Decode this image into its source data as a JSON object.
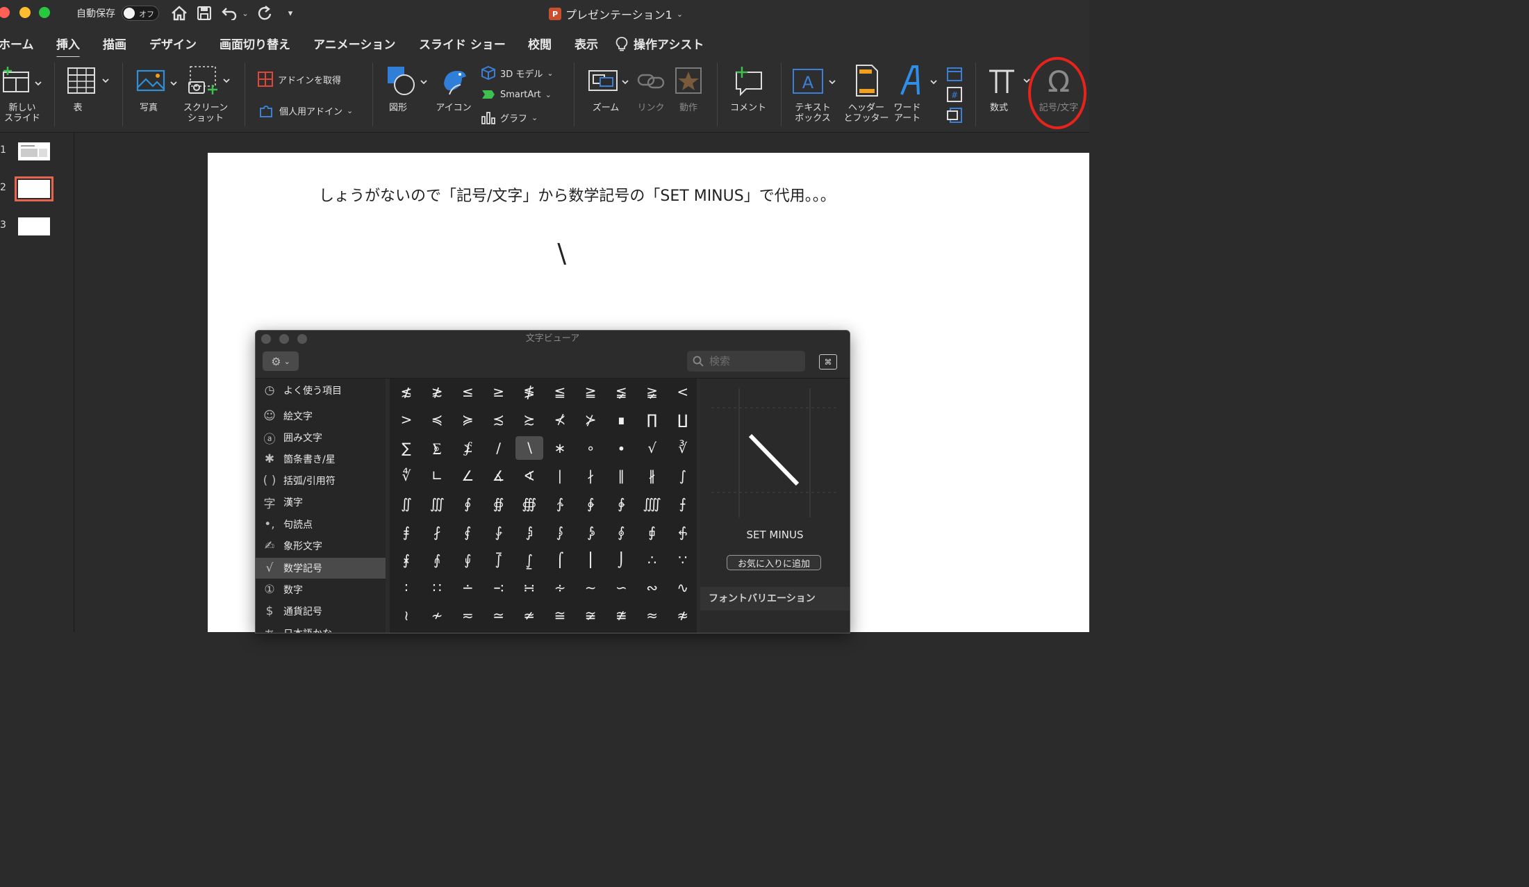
{
  "titlebar": {
    "autosave_label": "自動保存",
    "toggle_state": "オフ",
    "document_title": "プレゼンテーション1",
    "app_badge": "P"
  },
  "tabs": [
    "ホーム",
    "挿入",
    "描画",
    "デザイン",
    "画面切り替え",
    "アニメーション",
    "スライド ショー",
    "校閲",
    "表示",
    "操作アシスト"
  ],
  "active_tab": "挿入",
  "ribbon": {
    "new_slide": "新しい\nスライド",
    "table": "表",
    "photo": "写真",
    "screenshot": "スクリーン\nショット",
    "get_addins": "アドインを取得",
    "my_addins": "個人用アドイン",
    "shapes": "図形",
    "icons": "アイコン",
    "models3d": "3D モデル",
    "smartart": "SmartArt",
    "chart": "グラフ",
    "zoom": "ズーム",
    "link": "リンク",
    "action": "動作",
    "comment": "コメント",
    "textbox": "テキスト\nボックス",
    "header_footer": "ヘッダー\nとフッター",
    "wordart": "ワード\nアート",
    "equation": "数式",
    "symbol": "記号/文字"
  },
  "thumbnails": [
    "1",
    "2",
    "3"
  ],
  "selected_thumbnail": "2",
  "slide": {
    "text": "しょうがないので「記号/文字」から数学記号の「SET MINUS」で代用。。。",
    "symbol": "∖"
  },
  "char_viewer": {
    "title": "文字ビューア",
    "search_placeholder": "検索",
    "categories": [
      {
        "icon": "clock-icon",
        "glyph": "◷",
        "label": "よく使う項目"
      },
      {
        "icon": "smiley-icon",
        "glyph": "☺",
        "label": "絵文字"
      },
      {
        "icon": "circled-a-icon",
        "glyph": "ⓐ",
        "label": "囲み文字"
      },
      {
        "icon": "asterisk-icon",
        "glyph": "✱",
        "label": "箇条書き/星"
      },
      {
        "icon": "parentheses-icon",
        "glyph": "( )",
        "label": "括弧/引用符"
      },
      {
        "icon": "kanji-icon",
        "glyph": "字",
        "label": "漢字"
      },
      {
        "icon": "punctuation-icon",
        "glyph": "•,",
        "label": "句読点"
      },
      {
        "icon": "pictograph-icon",
        "glyph": "✍",
        "label": "象形文字"
      },
      {
        "icon": "sqrt-icon",
        "glyph": "√",
        "label": "数学記号"
      },
      {
        "icon": "circled-one-icon",
        "glyph": "①",
        "label": "数字"
      },
      {
        "icon": "dollar-icon",
        "glyph": "$",
        "label": "通貨記号"
      },
      {
        "icon": "kana-icon",
        "glyph": "あ",
        "label": "日本語かな"
      }
    ],
    "selected_category": "数学記号",
    "grid": [
      [
        "≴",
        "≵",
        "≤",
        "≥",
        "≸",
        "≦",
        "≧",
        "≨",
        "≩",
        "<"
      ],
      [
        ">",
        "≼",
        "≽",
        "≾",
        "≿",
        "⊀",
        "⊁",
        "∎",
        "∏",
        "∐"
      ],
      [
        "∑",
        "⨊",
        "⨋",
        "∕",
        "∖",
        "∗",
        "∘",
        "∙",
        "√",
        "∛"
      ],
      [
        "∜",
        "∟",
        "∠",
        "∡",
        "∢",
        "∣",
        "∤",
        "∥",
        "∦",
        "∫"
      ],
      [
        "∬",
        "∭",
        "∮",
        "∯",
        "∰",
        "∱",
        "∲",
        "∳",
        "⨌",
        "⨍"
      ],
      [
        "⨎",
        "⨏",
        "⨐",
        "⨑",
        "⨒",
        "⨓",
        "⨔",
        "⨕",
        "⨖",
        "⨗"
      ],
      [
        "⨘",
        "⨙",
        "⨚",
        "⨛",
        "⨜",
        "⌠",
        "⎮",
        "⌡",
        "∴",
        "∵"
      ],
      [
        "∶",
        "∷",
        "∸",
        "∹",
        "∺",
        "∻",
        "∼",
        "∽",
        "∾",
        "∿"
      ],
      [
        "≀",
        "≁",
        "≂",
        "≃",
        "≄",
        "≅",
        "≆",
        "≇",
        "≈",
        "≉"
      ]
    ],
    "selected_glyph": "∖",
    "detail_name": "SET MINUS",
    "favorite_button": "お気に入りに追加",
    "font_variation_header": "フォントバリエーション"
  }
}
